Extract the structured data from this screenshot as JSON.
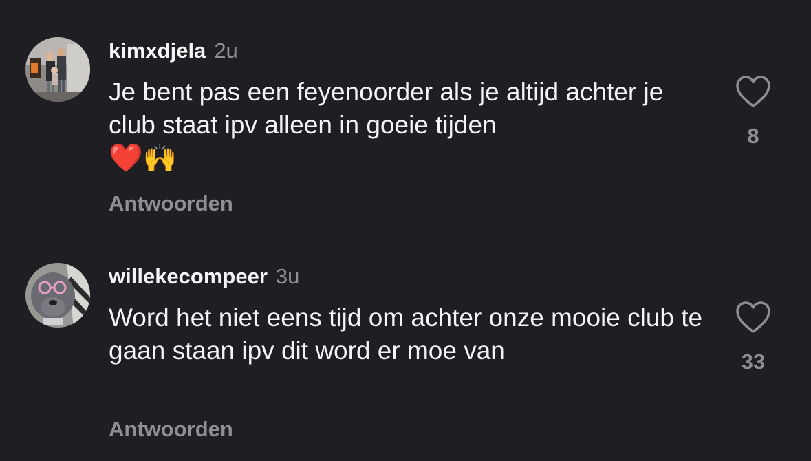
{
  "comments": [
    {
      "username": "kimxdjela",
      "time": "2u",
      "text": "Je bent pas een feyenoorder als je altijd achter je club staat ipv alleen in goeie tijden",
      "emojis": "❤️🙌",
      "reply_label": "Antwoorden",
      "likes": "8"
    },
    {
      "username": "willekecompeer",
      "time": "3u",
      "text": "Word het niet eens tijd om achter onze mooie club te gaan staan ipv dit word er moe van",
      "emojis": "",
      "reply_label": "Antwoorden",
      "likes": "33"
    }
  ],
  "colors": {
    "background": "#1f1f23",
    "primary_text": "#f5f5f7",
    "secondary_text": "#8e8e95"
  },
  "icons": {
    "like": "heart-outline-icon",
    "avatar1": "profile-photo-family",
    "avatar2": "profile-photo-dog-sunglasses"
  }
}
